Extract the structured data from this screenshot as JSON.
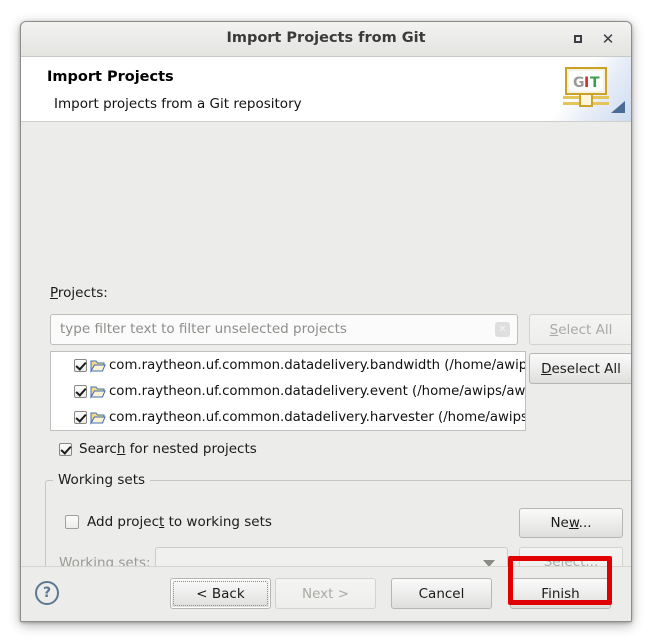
{
  "window": {
    "title": "Import Projects from Git",
    "maximize_icon": "maximize-icon",
    "close_icon": "close-icon",
    "close_glyph": "✕"
  },
  "header": {
    "title": "Import Projects",
    "subtitle": "Import projects from a Git repository",
    "banner_icon": "git-banner-icon",
    "git_letters": [
      "G",
      "I",
      "T"
    ]
  },
  "projects": {
    "label": "Projects:",
    "label_mnemonic": "P",
    "label_rest": "rojects:",
    "filter_placeholder": "type filter text to filter unselected projects",
    "clear_icon": "clear-filter-icon",
    "clear_glyph": "✕",
    "select_all": {
      "label": "Select All",
      "mnemonic": "S",
      "rest": "elect All",
      "enabled": false
    },
    "deselect_all": {
      "label": "Deselect All",
      "mnemonic": "D",
      "rest": "eselect All",
      "enabled": true
    },
    "items": [
      {
        "checked": true,
        "icon": "folder-icon",
        "label": "com.raytheon.uf.common.datadelivery.bandwidth (/home/awips/a"
      },
      {
        "checked": true,
        "icon": "folder-icon",
        "label": "com.raytheon.uf.common.datadelivery.event (/home/awips/awips"
      },
      {
        "checked": true,
        "icon": "folder-icon",
        "label": "com.raytheon.uf.common.datadelivery.harvester (/home/awips/av"
      }
    ],
    "nested": {
      "checked": true,
      "text_before": "Searc",
      "mnemonic": "h",
      "text_after": " for nested projects"
    }
  },
  "working_sets": {
    "group_title": "Working sets",
    "add_checkbox": {
      "checked": false,
      "text_before": "Add projec",
      "mnemonic": "t",
      "text_after": " to working sets"
    },
    "combo_label_before": "W",
    "combo_label_mnemonic": "o",
    "combo_label_after": "rking sets:",
    "combo_label": "Working sets:",
    "combo_label_enabled": false,
    "combo_value": "",
    "combo_arrow_icon": "chevron-down-icon",
    "new_button": {
      "label": "New...",
      "before": "Ne",
      "mnemonic": "w",
      "after": "...",
      "enabled": true
    },
    "select_button": {
      "label": "Select...",
      "before": "S",
      "mnemonic": "e",
      "after": "lect...",
      "enabled": false
    }
  },
  "footer": {
    "help_icon": "help-icon",
    "help_glyph": "?",
    "back": {
      "label": "< Back",
      "enabled": true,
      "focused": true
    },
    "next": {
      "label": "Next >",
      "enabled": false
    },
    "cancel": {
      "label": "Cancel",
      "enabled": true
    },
    "finish": {
      "label": "Finish",
      "enabled": true
    }
  },
  "annotation": {
    "target": "finish-button",
    "color": "#e00000"
  }
}
